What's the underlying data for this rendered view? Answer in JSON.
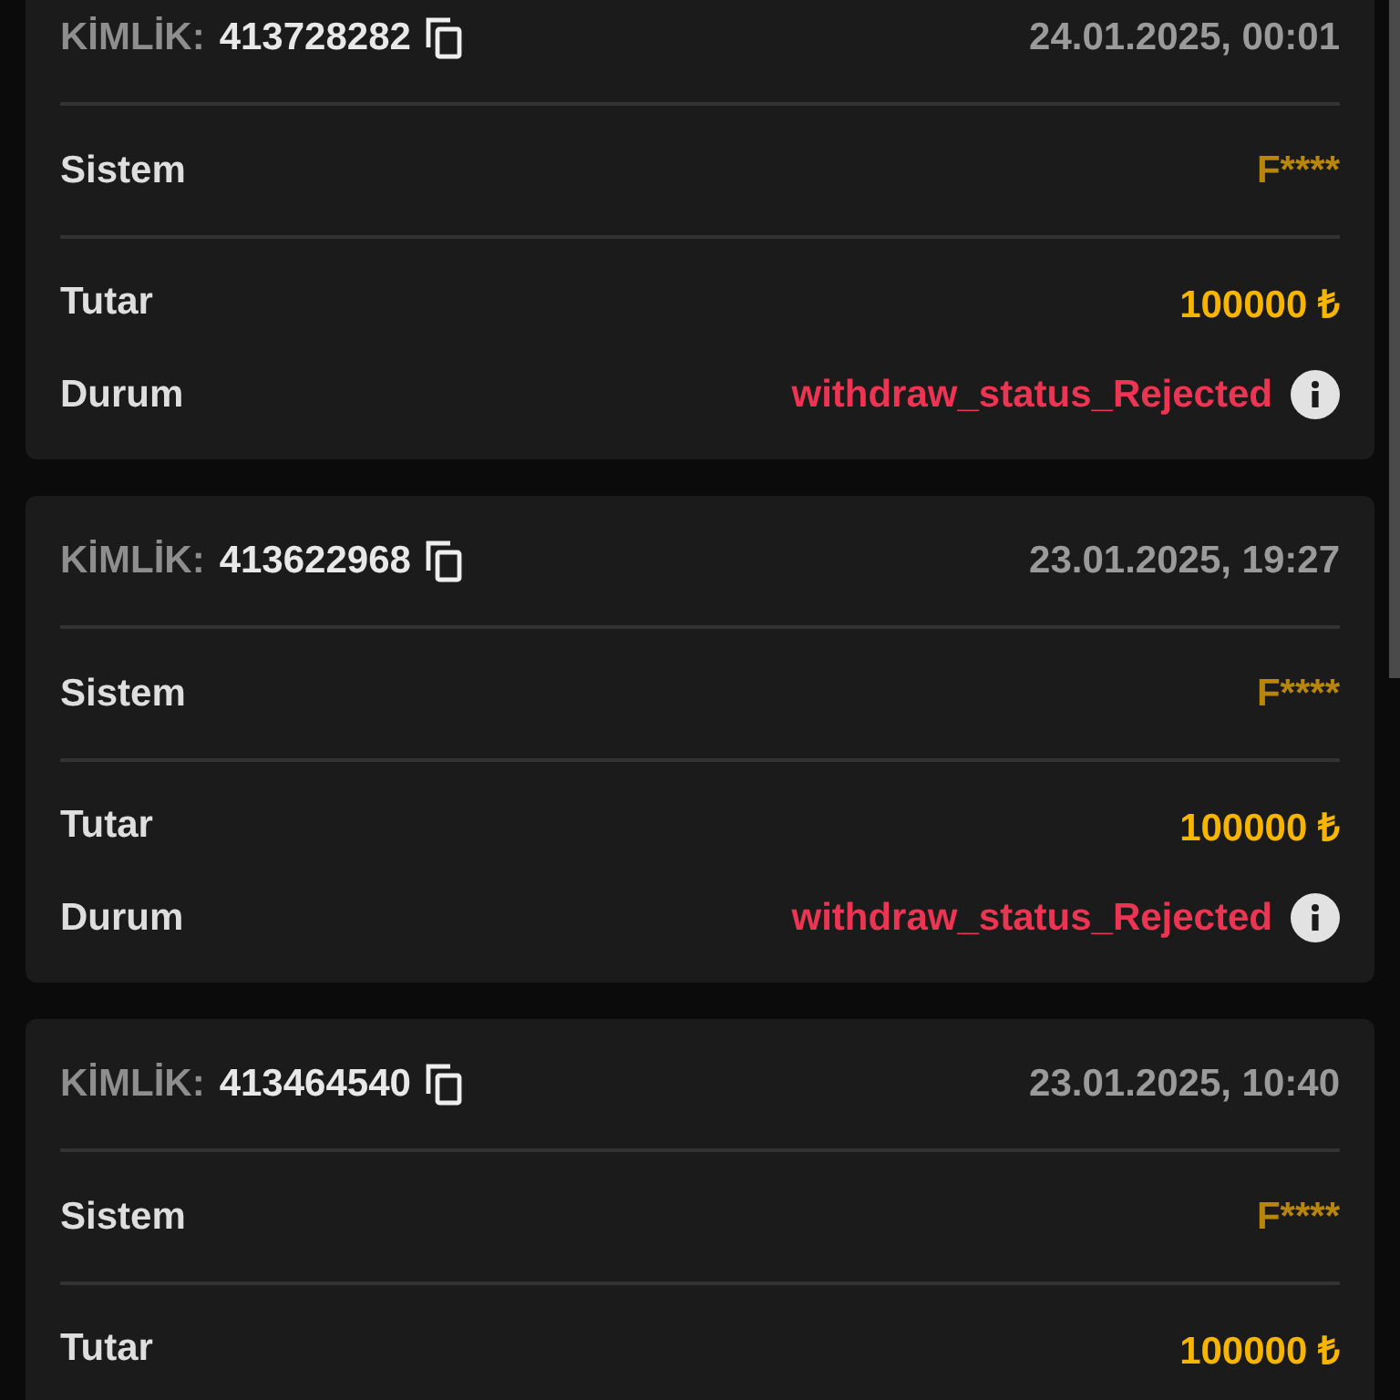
{
  "transactions": [
    {
      "id_label": "KİMLİK:",
      "id": "413728282",
      "date": "24.01.2025, 00:01",
      "system_label": "Sistem",
      "system": "F****",
      "amount_label": "Tutar",
      "amount": "100000 ₺",
      "status_label": "Durum",
      "status": "withdraw_status_Rejected"
    },
    {
      "id_label": "KİMLİK:",
      "id": "413622968",
      "date": "23.01.2025, 19:27",
      "system_label": "Sistem",
      "system": "F****",
      "amount_label": "Tutar",
      "amount": "100000 ₺",
      "status_label": "Durum",
      "status": "withdraw_status_Rejected"
    },
    {
      "id_label": "KİMLİK:",
      "id": "413464540",
      "date": "23.01.2025, 10:40",
      "system_label": "Sistem",
      "system": "F****",
      "amount_label": "Tutar",
      "amount": "100000 ₺"
    }
  ]
}
